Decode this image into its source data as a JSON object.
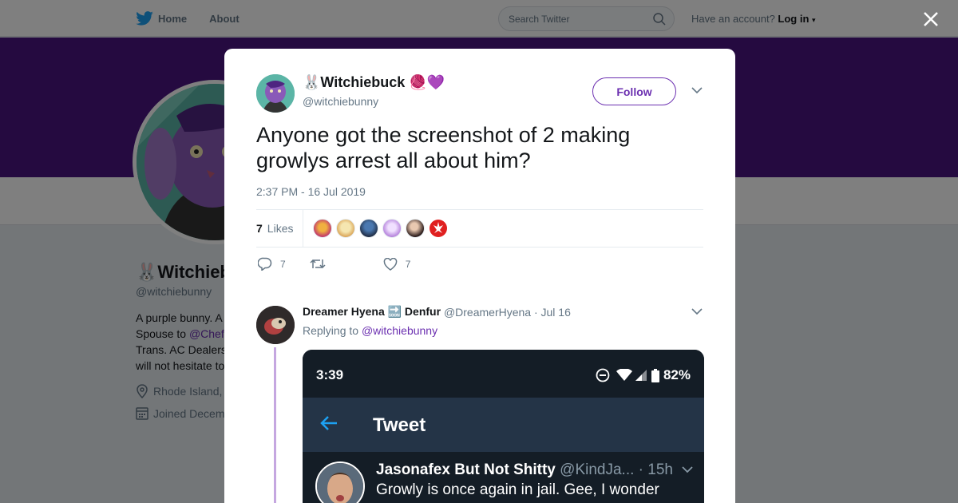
{
  "nav": {
    "home_label": "Home",
    "about_label": "About",
    "search_placeholder": "Search Twitter",
    "account_prompt": "Have an account?",
    "login_label": "Log in"
  },
  "profile_bg": {
    "name": "🐰Witchieb",
    "handle": "@witchiebunny",
    "bio_line1": "A purple bunny. A",
    "bio_line2_prefix": "Spouse to ",
    "bio_line2_link": "@Chef",
    "bio_line3": "Trans. AC Dealers",
    "bio_line4": "will not hesitate to",
    "location": "Rhode Island,",
    "joined": "Joined Decem"
  },
  "tweet": {
    "author_name": "🐰Witchiebuck 🧶💜",
    "author_handle": "@witchiebunny",
    "follow_label": "Follow",
    "text": "Anyone got the screenshot of 2 making growlys arrest all about him?",
    "timestamp": "2:37 PM - 16 Jul 2019",
    "likes_count": "7",
    "likes_label": "Likes",
    "reply_count": "7",
    "like_count": "7"
  },
  "reply": {
    "name": "Dreamer Hyena 🔜 Denfur",
    "handle": "@DreamerHyena",
    "date": "· Jul 16",
    "replying_prefix": "Replying to ",
    "replying_to": "@witchiebunny"
  },
  "embedded": {
    "time": "3:39",
    "battery": "82%",
    "title": "Tweet",
    "name": "Jasonafex But Not Shitty",
    "handle": "@KindJa...",
    "age": "· 15h",
    "text": "Growly is once again in jail. Gee, I wonder"
  },
  "colors": {
    "accent": "#6b2fb0",
    "banner": "#4b1480",
    "twitter_blue": "#1da1f2"
  }
}
